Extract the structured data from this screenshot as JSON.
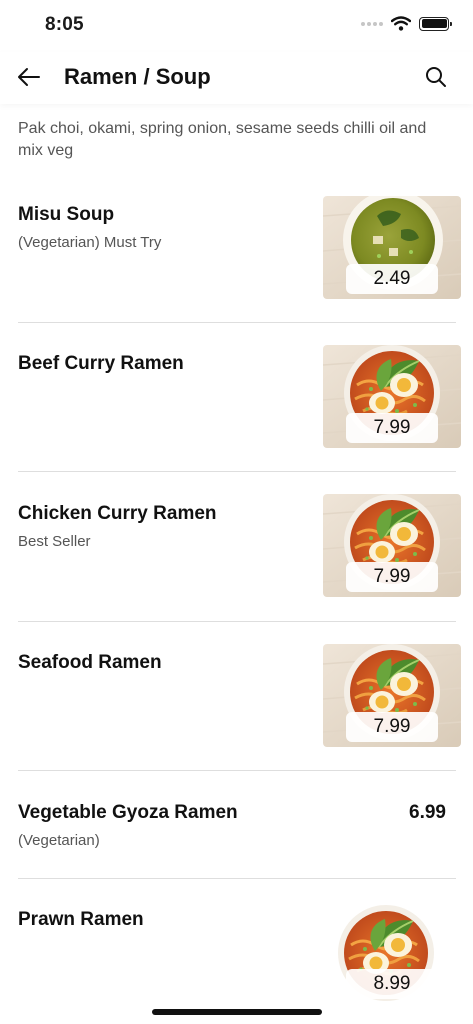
{
  "status_bar": {
    "time": "8:05"
  },
  "header": {
    "title": "Ramen / Soup"
  },
  "category": {
    "description": "Pak choi, okami, spring onion, sesame seeds chilli oil and mix veg"
  },
  "items": [
    {
      "name": "Misu Soup",
      "subtitle": "(Vegetarian) Must Try",
      "price": "2.49"
    },
    {
      "name": "Beef Curry Ramen",
      "subtitle": "",
      "price": "7.99"
    },
    {
      "name": "Chicken Curry Ramen",
      "subtitle": "Best Seller",
      "price": "7.99"
    },
    {
      "name": "Seafood Ramen",
      "subtitle": "",
      "price": "7.99"
    },
    {
      "name": "Vegetable Gyoza Ramen",
      "subtitle": "(Vegetarian)",
      "price": "6.99"
    },
    {
      "name": "Prawn Ramen",
      "subtitle": "",
      "price": "8.99"
    }
  ],
  "icons": {
    "back": "arrow-left-icon",
    "search": "search-icon",
    "wifi": "wifi-icon",
    "battery": "battery-icon"
  }
}
